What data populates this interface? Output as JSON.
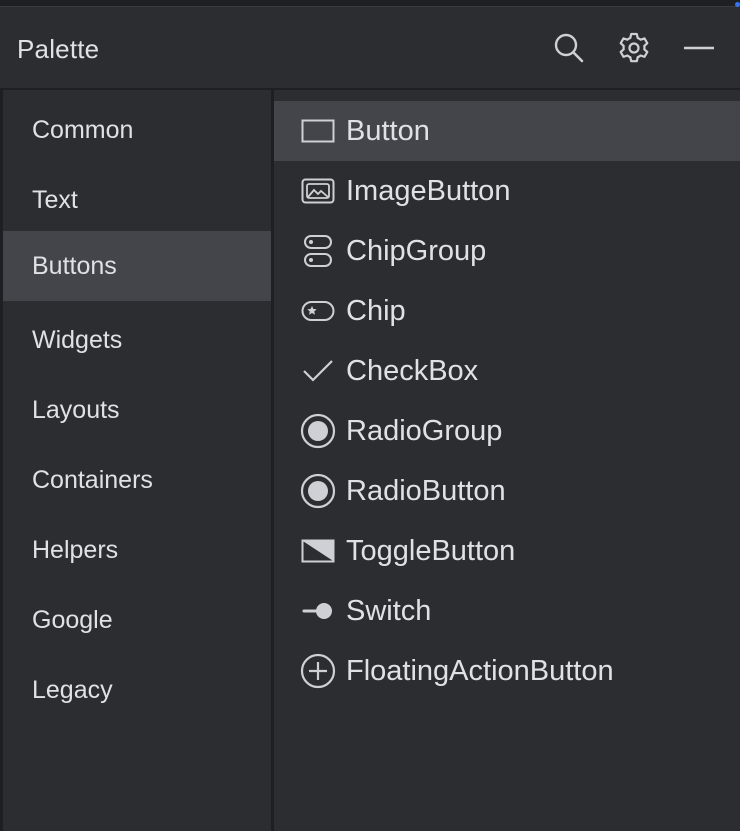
{
  "header": {
    "title": "Palette",
    "icons": [
      "search-icon",
      "gear-icon",
      "minimize-icon"
    ]
  },
  "sidebar": {
    "items": [
      {
        "label": "Common"
      },
      {
        "label": "Text"
      },
      {
        "label": "Buttons",
        "selected": true
      },
      {
        "label": "Widgets"
      },
      {
        "label": "Layouts"
      },
      {
        "label": "Containers"
      },
      {
        "label": "Helpers"
      },
      {
        "label": "Google"
      },
      {
        "label": "Legacy"
      }
    ]
  },
  "components": {
    "items": [
      {
        "label": "Button",
        "icon": "button-icon",
        "selected": true
      },
      {
        "label": "ImageButton",
        "icon": "image-button-icon"
      },
      {
        "label": "ChipGroup",
        "icon": "chip-group-icon"
      },
      {
        "label": "Chip",
        "icon": "chip-icon"
      },
      {
        "label": "CheckBox",
        "icon": "checkmark-icon"
      },
      {
        "label": "RadioGroup",
        "icon": "radio-group-icon"
      },
      {
        "label": "RadioButton",
        "icon": "radio-button-icon"
      },
      {
        "label": "ToggleButton",
        "icon": "toggle-button-icon"
      },
      {
        "label": "Switch",
        "icon": "switch-icon"
      },
      {
        "label": "FloatingActionButton",
        "icon": "fab-plus-icon"
      }
    ]
  },
  "colors": {
    "background": "#2b2d30",
    "border": "#1e1f22",
    "selection": "#43454a",
    "text": "#dfe1e5",
    "accent": "#3574f0"
  }
}
